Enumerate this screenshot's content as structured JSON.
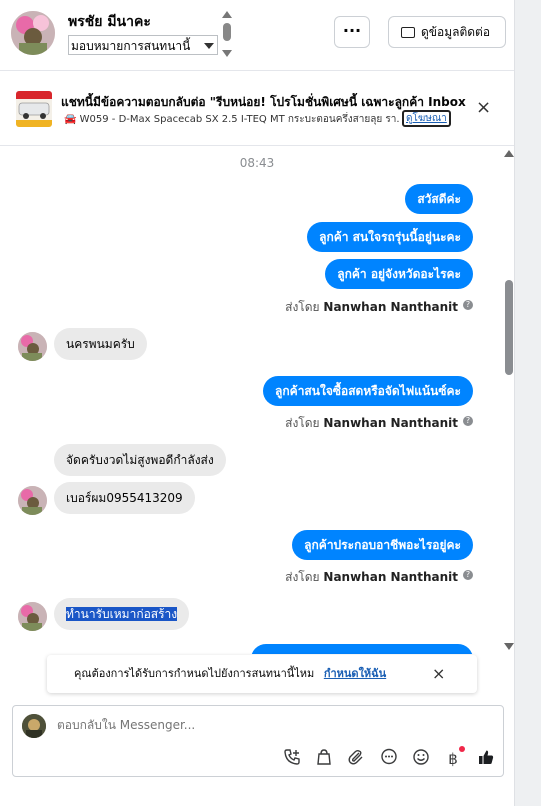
{
  "header": {
    "contact_name": "พรชัย มีนาคะ",
    "assign_label": "มอบหมายการสนทนานี้",
    "more_label": "···",
    "contact_info_label": "ดูข้อมูลติดต่อ"
  },
  "ad": {
    "title": "แชทนี้มีข้อความตอบกลับต่อ \"รีบหน่อย! โปรโมชั่นพิเศษนี้ เฉพาะลูกค้า Inbox",
    "subtitle": "W059 - D-Max Spacecab SX 2.5 I-TEQ MT กระบะตอนครึ่งสายลุย รา...",
    "link_label": "ดูโฆษณา",
    "close_icon": "×"
  },
  "thread": {
    "timestamp": "08:43",
    "messages": [
      {
        "dir": "out",
        "text": "สวัสดีค่ะ"
      },
      {
        "dir": "out",
        "text": "ลูกค้า สนใจรถรุ่นนี้อยู่นะคะ"
      },
      {
        "dir": "out",
        "text": "ลูกค้า อยู่จังหวัดอะไรคะ"
      },
      {
        "dir": "in",
        "text": "นครพนมครับ"
      },
      {
        "dir": "out",
        "text": "ลูกค้าสนใจซื้อสดหรือจัดไฟแน้นซ์คะ"
      },
      {
        "dir": "in",
        "text": "จัดครับงวดไม่สูงพอดีกำลังส่ง"
      },
      {
        "dir": "in",
        "text": "เบอร์ผม0955413209"
      },
      {
        "dir": "out",
        "text": "ลูกค้าประกอบอาชีพอะไรอยู่คะ"
      },
      {
        "dir": "in",
        "text": "ทำนารับเหมาก่อสร้าง"
      }
    ],
    "sent_by_prefix": "ส่งโดย",
    "sent_by_name": "Nanwhan Nanthanit",
    "help_glyph": "?"
  },
  "notice": {
    "text": "คุณต้องการได้รับการกำหนดไปยังการสนทนานี้ไหม",
    "link": "กำหนดให้ฉัน",
    "close_icon": "×"
  },
  "composer": {
    "placeholder": "ตอบกลับใน Messenger...",
    "tools": [
      "phone-plus-icon",
      "shopping-bag-icon",
      "paperclip-icon",
      "chat-bubble-icon",
      "smiley-icon",
      "baht-icon",
      "thumbs-up-icon"
    ]
  },
  "colors": {
    "outgoing_bubble": "#0084ff",
    "incoming_bubble": "#eaeaea",
    "link": "#1a5fb4",
    "highlight": "#1a56c7"
  }
}
